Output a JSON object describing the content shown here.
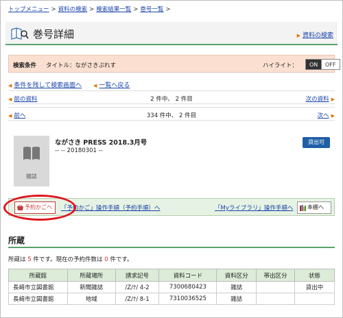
{
  "breadcrumb": [
    "トップメニュー",
    "資料の検索",
    "検索結果一覧",
    "巻号一覧"
  ],
  "breadcrumb_sep": ">",
  "header": {
    "title": "巻号詳細",
    "to_search_link": "資料の検索"
  },
  "search_conditions": {
    "label": "検索条件",
    "text": "タイトル：ながさきぷれす",
    "highlight_label": "ハイライト：",
    "on_label": "ON",
    "off_label": "OFF"
  },
  "links": {
    "keep_conditions": "条件を残して検索画面へ",
    "back_to_list": "一覧へ戻る"
  },
  "nav1": {
    "prev": "前の資料",
    "center": "2 件中、 2 件目",
    "next": "次の資料"
  },
  "nav2": {
    "prev": "前へ",
    "center": "334 件中、 2 件目",
    "next": "次へ"
  },
  "item": {
    "title": "ながさき PRESS 2018.3月号",
    "date": "-- -- 20180301 --",
    "type_label": "雑誌",
    "status_badge": "貸出可"
  },
  "cart_bar": {
    "cart_button": "予約かごへ",
    "cart_help": "「予約かご」操作手順（予約手順）へ",
    "mylib_help": "「Myライブラリ」操作手順へ",
    "shelf_button": "本棚へ"
  },
  "holdings": {
    "heading": "所蔵",
    "summary_prefix": "所蔵は",
    "count": "5",
    "summary_mid": "件です。現在の予約件数は",
    "reserve_count": "0",
    "summary_suffix": "件です。",
    "columns": [
      "所蔵館",
      "所蔵場所",
      "請求記号",
      "資料コード",
      "資料区分",
      "帯出区分",
      "状態"
    ],
    "rows": [
      [
        "長崎市立図書館",
        "新聞雑誌",
        "/Z/ﾅ/ 4-2",
        "7300680423",
        "雑誌",
        "",
        "貸出中"
      ],
      [
        "長崎市立図書館",
        "地域",
        "/Z/ﾅ/ 8-1",
        "7310036525",
        "雑誌",
        "",
        ""
      ]
    ]
  },
  "colors": {
    "accent_green": "#5aa16c",
    "cond_bg": "#fbe0d1",
    "link": "#1a44a8",
    "highlight_circle": "#e0141b"
  }
}
